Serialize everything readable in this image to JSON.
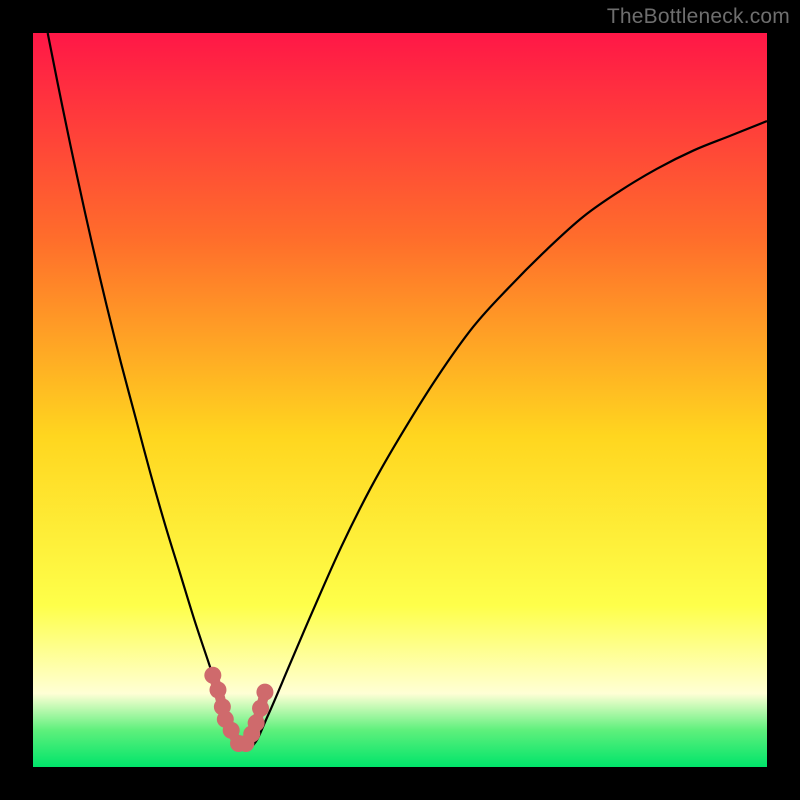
{
  "watermark": "TheBottleneck.com",
  "colors": {
    "background": "#000000",
    "gradient_top": "#ff1747",
    "gradient_upper_mid": "#ff6d2b",
    "gradient_mid": "#ffd61f",
    "gradient_lower_mid": "#feff4a",
    "gradient_pale": "#ffffd5",
    "gradient_green_mid": "#5ef07c",
    "gradient_bottom": "#00e46a",
    "curve": "#000000",
    "marker_fill": "#cf6a6c",
    "marker_stroke": "#cf6a6c"
  },
  "chart_data": {
    "type": "line",
    "title": "",
    "xlabel": "",
    "ylabel": "",
    "xlim": [
      0,
      100
    ],
    "ylim": [
      0,
      100
    ],
    "grid": false,
    "legend": false,
    "series": [
      {
        "name": "bottleneck-curve",
        "x": [
          2,
          4,
          6,
          8,
          10,
          12,
          14,
          16,
          18,
          20,
          22,
          24,
          26,
          27,
          28,
          30,
          32,
          35,
          38,
          42,
          46,
          50,
          55,
          60,
          65,
          70,
          75,
          80,
          85,
          90,
          95,
          100
        ],
        "values": [
          100,
          90,
          80.5,
          71.5,
          63,
          55,
          47.5,
          40,
          33,
          26.5,
          20,
          14,
          8,
          5,
          3,
          3,
          7,
          14,
          21,
          30,
          38,
          45,
          53,
          60,
          65.5,
          70.5,
          75,
          78.5,
          81.5,
          84,
          86,
          88
        ]
      }
    ],
    "valley_markers": {
      "name": "valley-points",
      "x": [
        24.5,
        25.2,
        25.8,
        26.2,
        27,
        28,
        29,
        29.8,
        30.4,
        31,
        31.6
      ],
      "values": [
        12.5,
        10.5,
        8.2,
        6.5,
        5,
        3.2,
        3.2,
        4.5,
        6,
        8,
        10.2
      ]
    }
  }
}
